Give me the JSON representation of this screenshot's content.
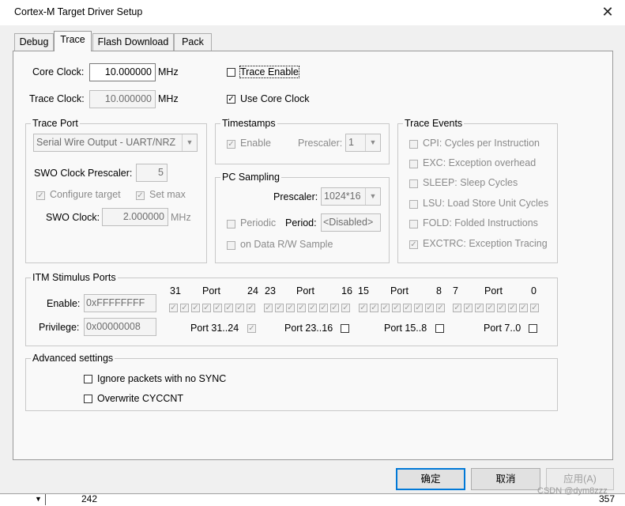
{
  "window": {
    "title": "Cortex-M Target Driver Setup",
    "close_glyph": "✕"
  },
  "tabs": [
    "Debug",
    "Trace",
    "Flash Download",
    "Pack"
  ],
  "clock": {
    "core_label": "Core Clock:",
    "core_value": "10.000000",
    "core_unit": "MHz",
    "trace_label": "Trace Clock:",
    "trace_value": "10.000000",
    "trace_unit": "MHz",
    "trace_enable_label": "Trace Enable",
    "use_core_clock_label": "Use Core Clock"
  },
  "trace_port": {
    "title": "Trace Port",
    "select_value": "Serial Wire Output - UART/NRZ",
    "swo_prescaler_label": "SWO Clock Prescaler:",
    "swo_prescaler_value": "5",
    "configure_target_label": "Configure target",
    "set_max_label": "Set max",
    "swo_clock_label": "SWO Clock:",
    "swo_clock_value": "2.000000",
    "swo_clock_unit": "MHz"
  },
  "timestamps": {
    "title": "Timestamps",
    "enable_label": "Enable",
    "prescaler_label": "Prescaler:",
    "prescaler_value": "1"
  },
  "pc_sampling": {
    "title": "PC Sampling",
    "prescaler_label": "Prescaler:",
    "prescaler_value": "1024*16",
    "periodic_label": "Periodic",
    "period_label": "Period:",
    "period_value": "<Disabled>",
    "on_data_label": "on Data R/W Sample"
  },
  "trace_events": {
    "title": "Trace Events",
    "items": [
      "CPI: Cycles per Instruction",
      "EXC: Exception overhead",
      "SLEEP: Sleep Cycles",
      "LSU: Load Store Unit Cycles",
      "FOLD: Folded Instructions",
      "EXCTRC: Exception Tracing"
    ]
  },
  "itm": {
    "title": "ITM Stimulus Ports",
    "enable_label": "Enable:",
    "enable_value": "0xFFFFFFFF",
    "privilege_label": "Privilege:",
    "privilege_value": "0x00000008",
    "header": [
      "31",
      "Port",
      "24",
      "23",
      "Port",
      "16",
      "15",
      "Port",
      "8",
      "7",
      "Port",
      "0"
    ],
    "port_groups": [
      "Port 31..24",
      "Port 23..16",
      "Port 15..8",
      "Port 7..0"
    ]
  },
  "advanced": {
    "title": "Advanced settings",
    "ignore_label": "Ignore packets with no SYNC",
    "overwrite_label": "Overwrite CYCCNT"
  },
  "buttons": {
    "ok": "确定",
    "cancel": "取消",
    "apply": "应用(A)"
  },
  "background": {
    "left_number": "242",
    "right_number": "357",
    "watermark": "CSDN @dym8zzz"
  }
}
